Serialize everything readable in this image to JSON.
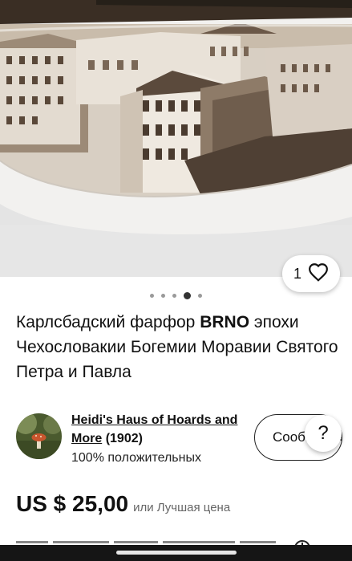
{
  "photo": {
    "image_icon": "porcelain-plate-photo"
  },
  "like": {
    "count": "1",
    "icon": "heart-outline-icon"
  },
  "carousel": {
    "total": 5,
    "active_index": 3
  },
  "listing": {
    "title_part1": "Карлсбадский фарфор ",
    "title_bold": "BRNO",
    "title_part2": " эпохи Чехословакии Богемии Моравии Святого Петра и Павла"
  },
  "seller": {
    "name": "Heidi's Haus of Hoards and More",
    "count": "(1902)",
    "feedback": "100% положительных",
    "message_button": "Сообщение",
    "avatar_icon": "mushroom-avatar"
  },
  "help": {
    "label": "?"
  },
  "price": {
    "amount": "US $ 25,00",
    "best_offer": "или Лучшая цена"
  },
  "colors": {
    "background": "#ffffff",
    "text": "#111111",
    "secondary_text": "#666666",
    "nav_bar": "#151515"
  }
}
